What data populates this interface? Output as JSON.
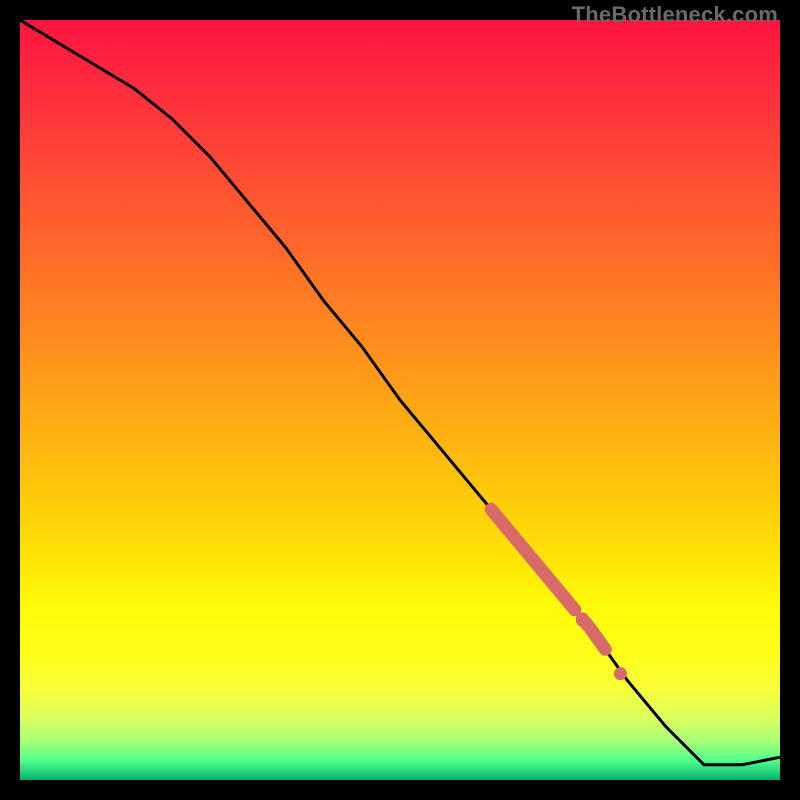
{
  "watermark": "TheBottleneck.com",
  "colors": {
    "gradient_stops": [
      {
        "offset": 0.0,
        "color": "#ff1440"
      },
      {
        "offset": 0.08,
        "color": "#ff2a3e"
      },
      {
        "offset": 0.16,
        "color": "#ff4038"
      },
      {
        "offset": 0.24,
        "color": "#ff5730"
      },
      {
        "offset": 0.32,
        "color": "#ff6e28"
      },
      {
        "offset": 0.4,
        "color": "#ff8620"
      },
      {
        "offset": 0.48,
        "color": "#ff9e18"
      },
      {
        "offset": 0.56,
        "color": "#ffb610"
      },
      {
        "offset": 0.64,
        "color": "#ffce08"
      },
      {
        "offset": 0.7,
        "color": "#ffe004"
      },
      {
        "offset": 0.77,
        "color": "#fffb06"
      },
      {
        "offset": 0.83,
        "color": "#ffff18"
      },
      {
        "offset": 0.88,
        "color": "#f8ff38"
      },
      {
        "offset": 0.92,
        "color": "#d9ff60"
      },
      {
        "offset": 0.95,
        "color": "#a6ff7a"
      },
      {
        "offset": 0.975,
        "color": "#4eff8b"
      },
      {
        "offset": 1.0,
        "color": "#02b06c"
      }
    ],
    "curve": "#000000",
    "highlight": "#d86a6a"
  },
  "chart_data": {
    "type": "line",
    "title": "",
    "xlabel": "",
    "ylabel": "",
    "xlim": [
      0,
      100
    ],
    "ylim": [
      0,
      100
    ],
    "series": [
      {
        "name": "bottleneck-curve",
        "x": [
          0,
          5,
          10,
          15,
          20,
          25,
          30,
          35,
          40,
          45,
          50,
          55,
          60,
          65,
          70,
          75,
          80,
          85,
          90,
          95,
          100
        ],
        "y": [
          100,
          97,
          94,
          91,
          87,
          82,
          76,
          70,
          63,
          57,
          50,
          44,
          38,
          32,
          26,
          20,
          13,
          7,
          2,
          2,
          3
        ]
      }
    ],
    "highlight_ranges": [
      {
        "x_start": 62,
        "x_end": 73,
        "style": "thick"
      },
      {
        "x_start": 74,
        "x_end": 77,
        "style": "thick"
      }
    ],
    "highlight_points": [
      {
        "x": 74,
        "y": 21
      },
      {
        "x": 79,
        "y": 14
      }
    ]
  }
}
